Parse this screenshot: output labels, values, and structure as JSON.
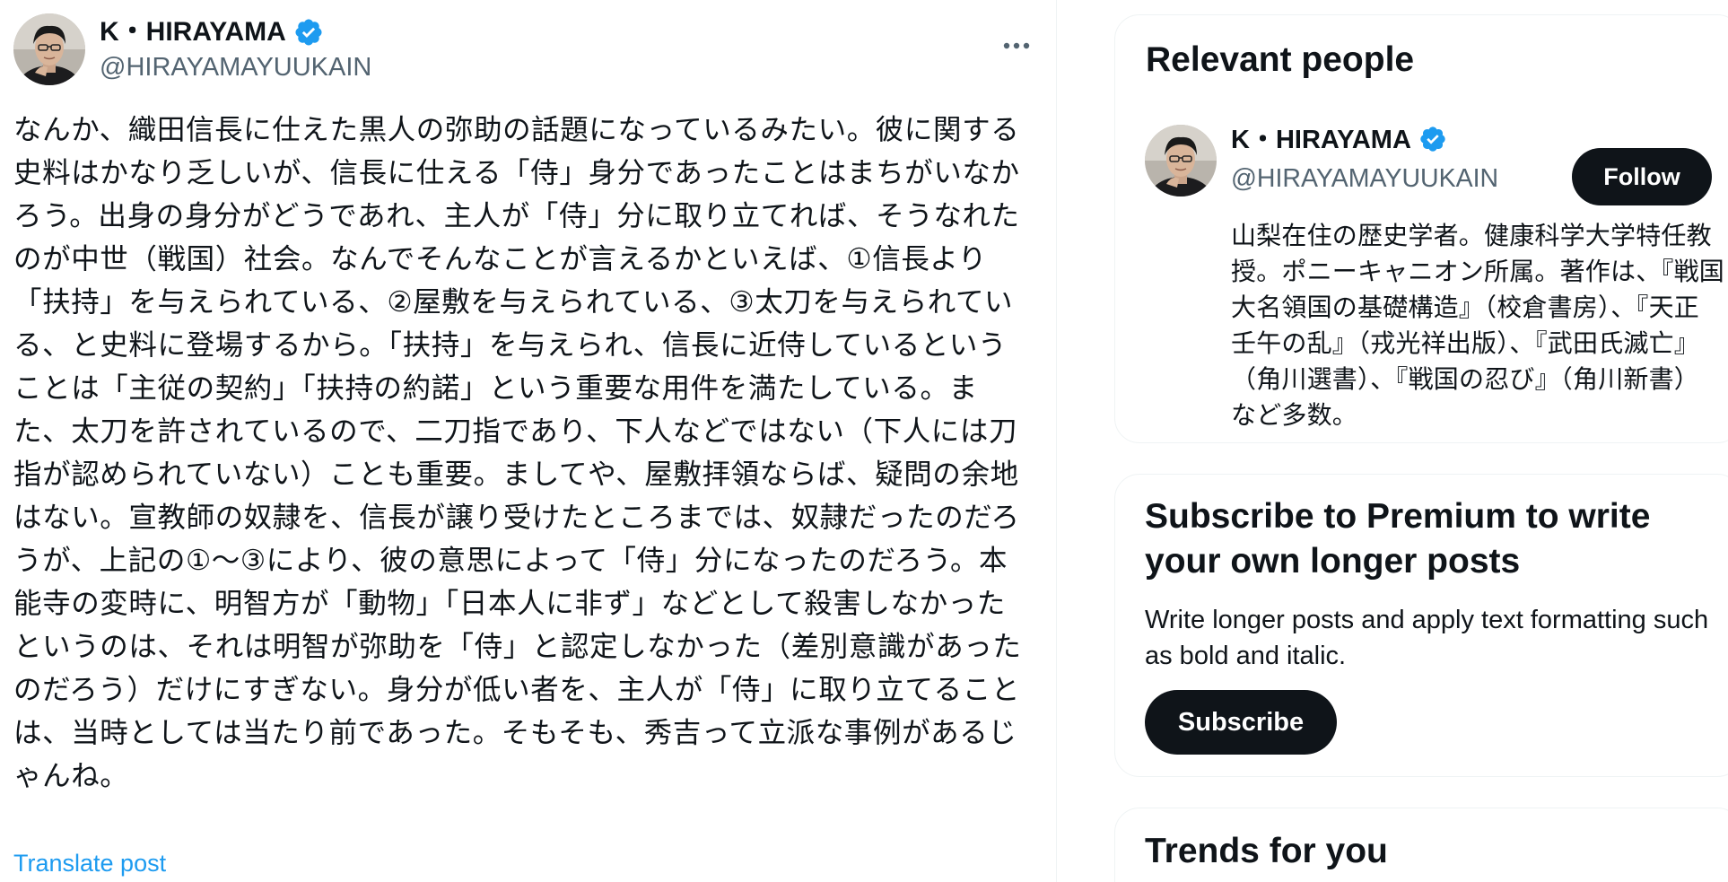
{
  "post": {
    "author": {
      "display_name": "K・HIRAYAMA",
      "handle": "@HIRAYAMAYUUKAIN",
      "verified": true,
      "avatar_icon": "avatar-photo"
    },
    "more_icon": "more-horizontal-icon",
    "text": "なんか、織田信長に仕えた黒人の弥助の話題になっているみたい。彼に関する史料はかなり乏しいが、信長に仕える「侍」身分であったことはまちがいなかろう。出身の身分がどうであれ、主人が「侍」分に取り立てれば、そうなれたのが中世（戦国）社会。なんでそんなことが言えるかといえば、①信長より「扶持」を与えられている、②屋敷を与えられている、③太刀を与えられている、と史料に登場するから。「扶持」を与えられ、信長に近侍しているということは「主従の契約」「扶持の約諾」という重要な用件を満たしている。また、太刀を許されているので、二刀指であり、下人などではない（下人には刀指が認められていない）ことも重要。ましてや、屋敷拝領ならば、疑問の余地はない。宣教師の奴隷を、信長が譲り受けたところまでは、奴隷だったのだろうが、上記の①〜③により、彼の意思によって「侍」分になったのだろう。本能寺の変時に、明智方が「動物」「日本人に非ず」などとして殺害しなかったというのは、それは明智が弥助を「侍」と認定しなかった（差別意識があったのだろう）だけにすぎない。身分が低い者を、主人が「侍」に取り立てることは、当時としては当たり前であった。そもそも、秀吉って立派な事例があるじゃんね。",
    "translate_label": "Translate post"
  },
  "sidebar": {
    "relevant_people": {
      "title": "Relevant people",
      "person": {
        "display_name": "K・HIRAYAMA",
        "handle": "@HIRAYAMAYUUKAIN",
        "verified": true,
        "follow_label": "Follow",
        "bio": "山梨在住の歴史学者。健康科学大学特任教授。ポニーキャニオン所属。著作は、『戦国大名領国の基礎構造』（校倉書房）、『天正壬午の乱』（戎光祥出版）、『武田氏滅亡』（角川選書）、『戦国の忍び』（角川新書）など多数。"
      }
    },
    "premium": {
      "title": "Subscribe to Premium to write your own longer posts",
      "description": "Write longer posts and apply text formatting such as bold and italic.",
      "subscribe_label": "Subscribe"
    },
    "trends": {
      "title": "Trends for you"
    }
  },
  "colors": {
    "text_primary": "#0f1419",
    "text_secondary": "#536471",
    "link": "#1d9bf0",
    "verified_badge": "#1d9bf0",
    "button_dark": "#0f1419",
    "border": "#eff3f4"
  }
}
